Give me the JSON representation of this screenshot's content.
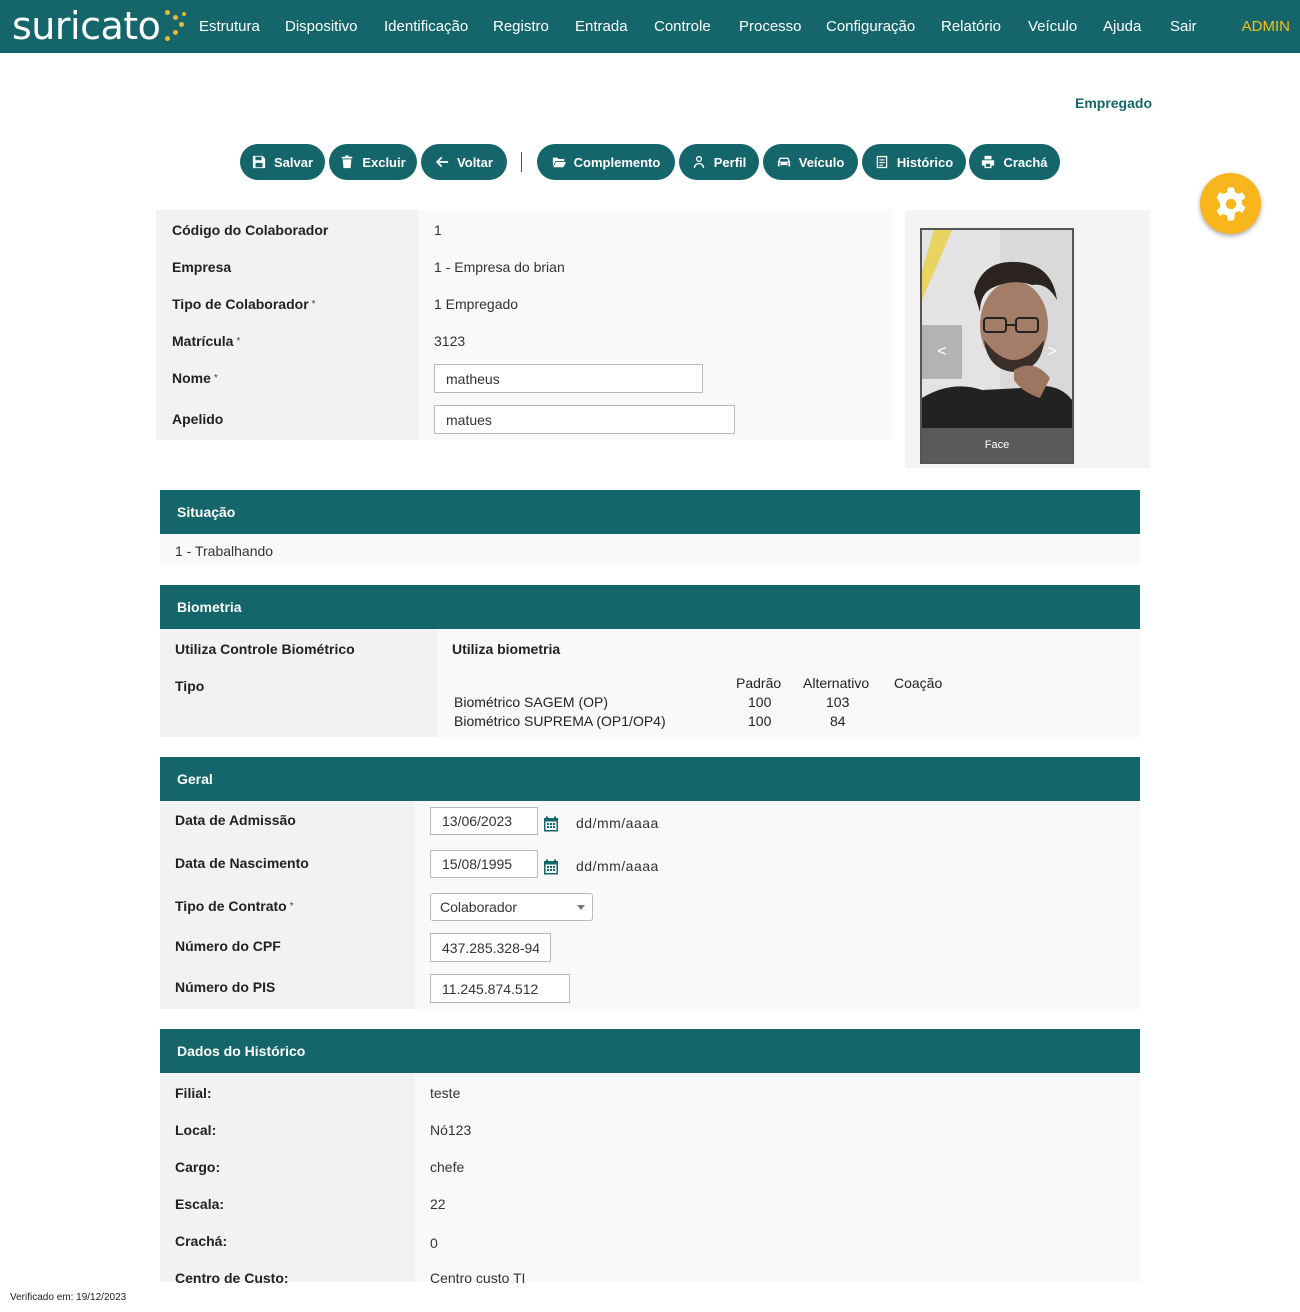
{
  "brand": {
    "logo_text": "suricato"
  },
  "nav": {
    "items": [
      "Estrutura",
      "Dispositivo",
      "Identificação",
      "Registro",
      "Entrada",
      "Controle",
      "Processo",
      "Configuração",
      "Relatório",
      "Veículo",
      "Ajuda",
      "Sair"
    ],
    "user": "ADMIN"
  },
  "page_title": "Empregado",
  "toolbar": {
    "save": "Salvar",
    "delete": "Excluir",
    "back": "Voltar",
    "complement": "Complemento",
    "profile": "Perfil",
    "vehicle": "Veículo",
    "history": "Histórico",
    "badge": "Crachá"
  },
  "colaborador": {
    "code_label": "Código do Colaborador",
    "code_value": "1",
    "company_label": "Empresa",
    "company_value": "1 - Empresa do brian",
    "type_label": "Tipo de Colaborador",
    "type_value": "1 Empregado",
    "registration_label": "Matrícula",
    "registration_value": "3123",
    "name_label": "Nome",
    "name_value": "matheus",
    "nickname_label": "Apelido",
    "nickname_value": "matues",
    "required_mark": "*"
  },
  "photo": {
    "caption": "Face",
    "prev": "<",
    "next": ">"
  },
  "situacao": {
    "title": "Situação",
    "value": "1 - Trabalhando"
  },
  "biometria": {
    "title": "Biometria",
    "uses_label": "Utiliza Controle Biométrico",
    "uses_value": "Utiliza biometria",
    "type_label": "Tipo",
    "columns": [
      "Padrão",
      "Alternativo",
      "Coação"
    ],
    "rows": [
      {
        "name": "Biométrico SAGEM (OP)",
        "padrao": "100",
        "alternativo": "103",
        "coacao": ""
      },
      {
        "name": "Biométrico SUPREMA (OP1/OP4)",
        "padrao": "100",
        "alternativo": "84",
        "coacao": ""
      }
    ]
  },
  "geral": {
    "title": "Geral",
    "admission_label": "Data de Admissão",
    "admission_value": "13/06/2023",
    "birth_label": "Data de Nascimento",
    "birth_value": "15/08/1995",
    "date_format": "dd/mm/aaaa",
    "contract_label": "Tipo de Contrato",
    "contract_value": "Colaborador",
    "cpf_label": "Número do CPF",
    "cpf_value": "437.285.328-94",
    "pis_label": "Número do PIS",
    "pis_value": "11.245.874.512",
    "required_mark": "*"
  },
  "historico": {
    "title": "Dados do Histórico",
    "rows": [
      {
        "label": "Filial:",
        "value": "teste"
      },
      {
        "label": "Local:",
        "value": "Nó123"
      },
      {
        "label": "Cargo:",
        "value": "chefe"
      },
      {
        "label": "Escala:",
        "value": "22"
      },
      {
        "label": "Crachá:",
        "value": "0"
      },
      {
        "label": "Centro de Custo:",
        "value": "Centro custo TI"
      }
    ]
  },
  "footer": {
    "verified": "Verificado em: 19/12/2023"
  },
  "colors": {
    "primary": "#14666b",
    "accent": "#f9b61c",
    "admin": "#f5c11a"
  }
}
